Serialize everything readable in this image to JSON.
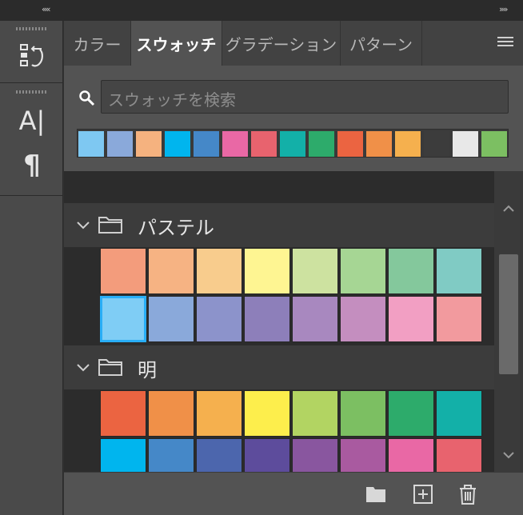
{
  "topbar": {
    "collapse_left": "««",
    "collapse_right": "»»"
  },
  "tools": [
    {
      "name": "history-tool",
      "icon": "history-icon"
    },
    {
      "name": "character-tool",
      "icon": "character-icon",
      "glyph": "A|"
    },
    {
      "name": "paragraph-tool",
      "icon": "paragraph-icon",
      "glyph": "¶"
    }
  ],
  "tabs": [
    {
      "label": "カラー",
      "active": false
    },
    {
      "label": "スウォッチ",
      "active": true
    },
    {
      "label": "グラデーション",
      "active": false
    },
    {
      "label": "パターン",
      "active": false
    }
  ],
  "search": {
    "placeholder": "スウォッチを検索"
  },
  "recent_colors": [
    "#7ec8f2",
    "#8aa9da",
    "#f5b27f",
    "#00b5ee",
    "#4588c8",
    "#e968a5",
    "#e8636e",
    "#13b0a8",
    "#2dab6b",
    "#eb6441",
    "#f09048",
    "#f5b04e",
    "#3c3c3c",
    "#e8e8e8",
    "#7cbf62"
  ],
  "groups": [
    {
      "name": "パステル",
      "rows": [
        [
          "#f39c7c",
          "#f6b383",
          "#f8cc8d",
          "#fef592",
          "#cde2a0",
          "#a6d694",
          "#84c89c",
          "#80cbc4"
        ],
        [
          "#7fcdf5",
          "#8aa9da",
          "#8c93cb",
          "#8d7fba",
          "#a888bf",
          "#c48ebf",
          "#f29fc3",
          "#f29a9e"
        ]
      ],
      "selected": [
        1,
        0
      ]
    },
    {
      "name": "明",
      "rows": [
        [
          "#eb6441",
          "#f09048",
          "#f5b04e",
          "#fdee4c",
          "#b2d462",
          "#7cbf62",
          "#2dab6b",
          "#13b0a8"
        ],
        [
          "#00b5ee",
          "#4588c8",
          "#4c66ad",
          "#5d4c9c",
          "#89569f",
          "#a95aa0",
          "#e968a5",
          "#e8636e"
        ]
      ]
    }
  ],
  "bottom_actions": [
    "new-group",
    "new-swatch",
    "delete"
  ]
}
